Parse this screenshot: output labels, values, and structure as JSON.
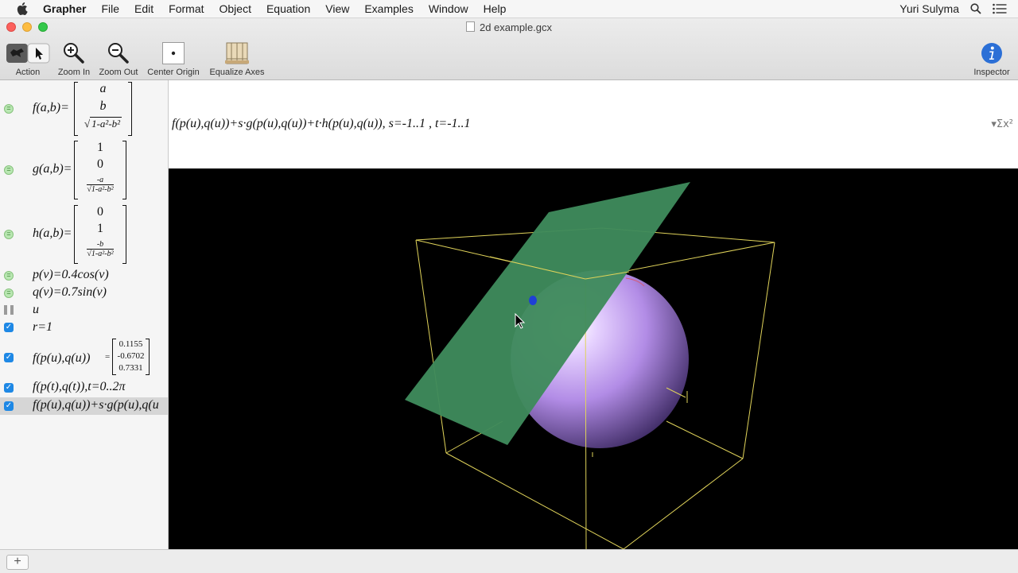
{
  "menubar": {
    "app_name": "Grapher",
    "items": [
      "File",
      "Edit",
      "Format",
      "Object",
      "Equation",
      "View",
      "Examples",
      "Window",
      "Help"
    ],
    "user": "Yuri Sulyma"
  },
  "window": {
    "title": "2d example.gcx"
  },
  "toolbar": {
    "action": "Action",
    "zoom_in": "Zoom In",
    "zoom_out": "Zoom Out",
    "center_origin": "Center Origin",
    "equalize_axes": "Equalize Axes",
    "inspector": "Inspector"
  },
  "sidebar": {
    "f_lhs": "f(a,b)=",
    "f_vec": [
      "a",
      "b",
      "1-a²-b²"
    ],
    "g_lhs": "g(a,b)=",
    "g_vec": [
      "1",
      "0",
      "-a",
      "1-a²-b²"
    ],
    "h_lhs": "h(a,b)=",
    "h_vec": [
      "0",
      "1",
      "-b",
      "1-a²-b²"
    ],
    "p_def": "p(v)=0.4cos(v)",
    "q_def": "q(v)=0.7sin(v)",
    "u_def": "u",
    "r_def": "r=1",
    "fpq_lhs": "f(p(u),q(u))",
    "fpq_eq": "=",
    "fpq_vals": [
      "0.1155",
      "-0.6702",
      "0.7331"
    ],
    "curve_def": "f(p(t),q(t)),t=0..2π",
    "plane_def": "f(p(u),q(u))+s·g(p(u),q(u"
  },
  "editor": {
    "expression": "f(p(u),q(u))+s·g(p(u),q(u))+t·h(p(u),q(u)), s=-1..1 , t=-1..1",
    "sigma_menu": "▾Σx²"
  },
  "graph": {
    "sphere_color": "#b28ce6",
    "plane_color": "#3e8a5c",
    "box_color": "#e0d35a",
    "point_color": "#1f3fd6"
  },
  "bottombar": {
    "add_label": "+"
  }
}
